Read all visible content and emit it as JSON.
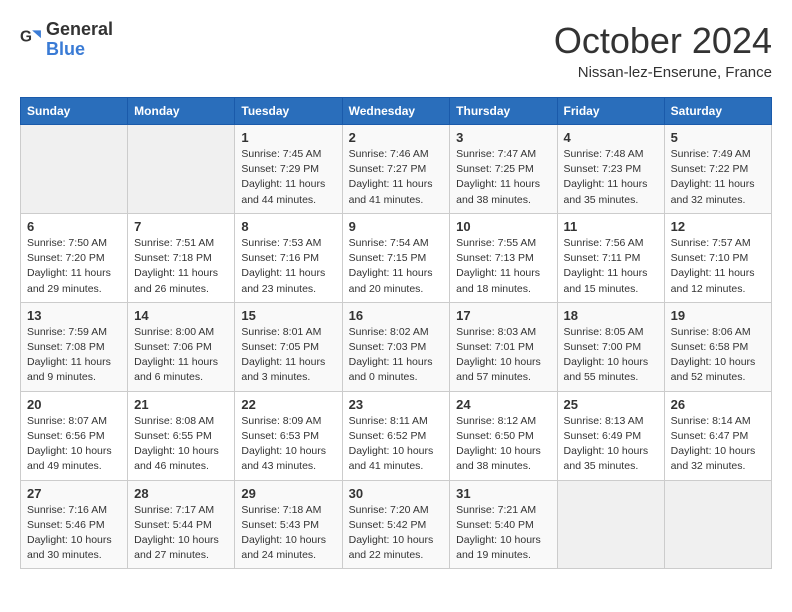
{
  "header": {
    "logo_general": "General",
    "logo_blue": "Blue",
    "title": "October 2024",
    "subtitle": "Nissan-lez-Enserune, France"
  },
  "columns": [
    "Sunday",
    "Monday",
    "Tuesday",
    "Wednesday",
    "Thursday",
    "Friday",
    "Saturday"
  ],
  "weeks": [
    [
      {
        "day": "",
        "detail": ""
      },
      {
        "day": "",
        "detail": ""
      },
      {
        "day": "1",
        "detail": "Sunrise: 7:45 AM\nSunset: 7:29 PM\nDaylight: 11 hours and 44 minutes."
      },
      {
        "day": "2",
        "detail": "Sunrise: 7:46 AM\nSunset: 7:27 PM\nDaylight: 11 hours and 41 minutes."
      },
      {
        "day": "3",
        "detail": "Sunrise: 7:47 AM\nSunset: 7:25 PM\nDaylight: 11 hours and 38 minutes."
      },
      {
        "day": "4",
        "detail": "Sunrise: 7:48 AM\nSunset: 7:23 PM\nDaylight: 11 hours and 35 minutes."
      },
      {
        "day": "5",
        "detail": "Sunrise: 7:49 AM\nSunset: 7:22 PM\nDaylight: 11 hours and 32 minutes."
      }
    ],
    [
      {
        "day": "6",
        "detail": "Sunrise: 7:50 AM\nSunset: 7:20 PM\nDaylight: 11 hours and 29 minutes."
      },
      {
        "day": "7",
        "detail": "Sunrise: 7:51 AM\nSunset: 7:18 PM\nDaylight: 11 hours and 26 minutes."
      },
      {
        "day": "8",
        "detail": "Sunrise: 7:53 AM\nSunset: 7:16 PM\nDaylight: 11 hours and 23 minutes."
      },
      {
        "day": "9",
        "detail": "Sunrise: 7:54 AM\nSunset: 7:15 PM\nDaylight: 11 hours and 20 minutes."
      },
      {
        "day": "10",
        "detail": "Sunrise: 7:55 AM\nSunset: 7:13 PM\nDaylight: 11 hours and 18 minutes."
      },
      {
        "day": "11",
        "detail": "Sunrise: 7:56 AM\nSunset: 7:11 PM\nDaylight: 11 hours and 15 minutes."
      },
      {
        "day": "12",
        "detail": "Sunrise: 7:57 AM\nSunset: 7:10 PM\nDaylight: 11 hours and 12 minutes."
      }
    ],
    [
      {
        "day": "13",
        "detail": "Sunrise: 7:59 AM\nSunset: 7:08 PM\nDaylight: 11 hours and 9 minutes."
      },
      {
        "day": "14",
        "detail": "Sunrise: 8:00 AM\nSunset: 7:06 PM\nDaylight: 11 hours and 6 minutes."
      },
      {
        "day": "15",
        "detail": "Sunrise: 8:01 AM\nSunset: 7:05 PM\nDaylight: 11 hours and 3 minutes."
      },
      {
        "day": "16",
        "detail": "Sunrise: 8:02 AM\nSunset: 7:03 PM\nDaylight: 11 hours and 0 minutes."
      },
      {
        "day": "17",
        "detail": "Sunrise: 8:03 AM\nSunset: 7:01 PM\nDaylight: 10 hours and 57 minutes."
      },
      {
        "day": "18",
        "detail": "Sunrise: 8:05 AM\nSunset: 7:00 PM\nDaylight: 10 hours and 55 minutes."
      },
      {
        "day": "19",
        "detail": "Sunrise: 8:06 AM\nSunset: 6:58 PM\nDaylight: 10 hours and 52 minutes."
      }
    ],
    [
      {
        "day": "20",
        "detail": "Sunrise: 8:07 AM\nSunset: 6:56 PM\nDaylight: 10 hours and 49 minutes."
      },
      {
        "day": "21",
        "detail": "Sunrise: 8:08 AM\nSunset: 6:55 PM\nDaylight: 10 hours and 46 minutes."
      },
      {
        "day": "22",
        "detail": "Sunrise: 8:09 AM\nSunset: 6:53 PM\nDaylight: 10 hours and 43 minutes."
      },
      {
        "day": "23",
        "detail": "Sunrise: 8:11 AM\nSunset: 6:52 PM\nDaylight: 10 hours and 41 minutes."
      },
      {
        "day": "24",
        "detail": "Sunrise: 8:12 AM\nSunset: 6:50 PM\nDaylight: 10 hours and 38 minutes."
      },
      {
        "day": "25",
        "detail": "Sunrise: 8:13 AM\nSunset: 6:49 PM\nDaylight: 10 hours and 35 minutes."
      },
      {
        "day": "26",
        "detail": "Sunrise: 8:14 AM\nSunset: 6:47 PM\nDaylight: 10 hours and 32 minutes."
      }
    ],
    [
      {
        "day": "27",
        "detail": "Sunrise: 7:16 AM\nSunset: 5:46 PM\nDaylight: 10 hours and 30 minutes."
      },
      {
        "day": "28",
        "detail": "Sunrise: 7:17 AM\nSunset: 5:44 PM\nDaylight: 10 hours and 27 minutes."
      },
      {
        "day": "29",
        "detail": "Sunrise: 7:18 AM\nSunset: 5:43 PM\nDaylight: 10 hours and 24 minutes."
      },
      {
        "day": "30",
        "detail": "Sunrise: 7:20 AM\nSunset: 5:42 PM\nDaylight: 10 hours and 22 minutes."
      },
      {
        "day": "31",
        "detail": "Sunrise: 7:21 AM\nSunset: 5:40 PM\nDaylight: 10 hours and 19 minutes."
      },
      {
        "day": "",
        "detail": ""
      },
      {
        "day": "",
        "detail": ""
      }
    ]
  ]
}
